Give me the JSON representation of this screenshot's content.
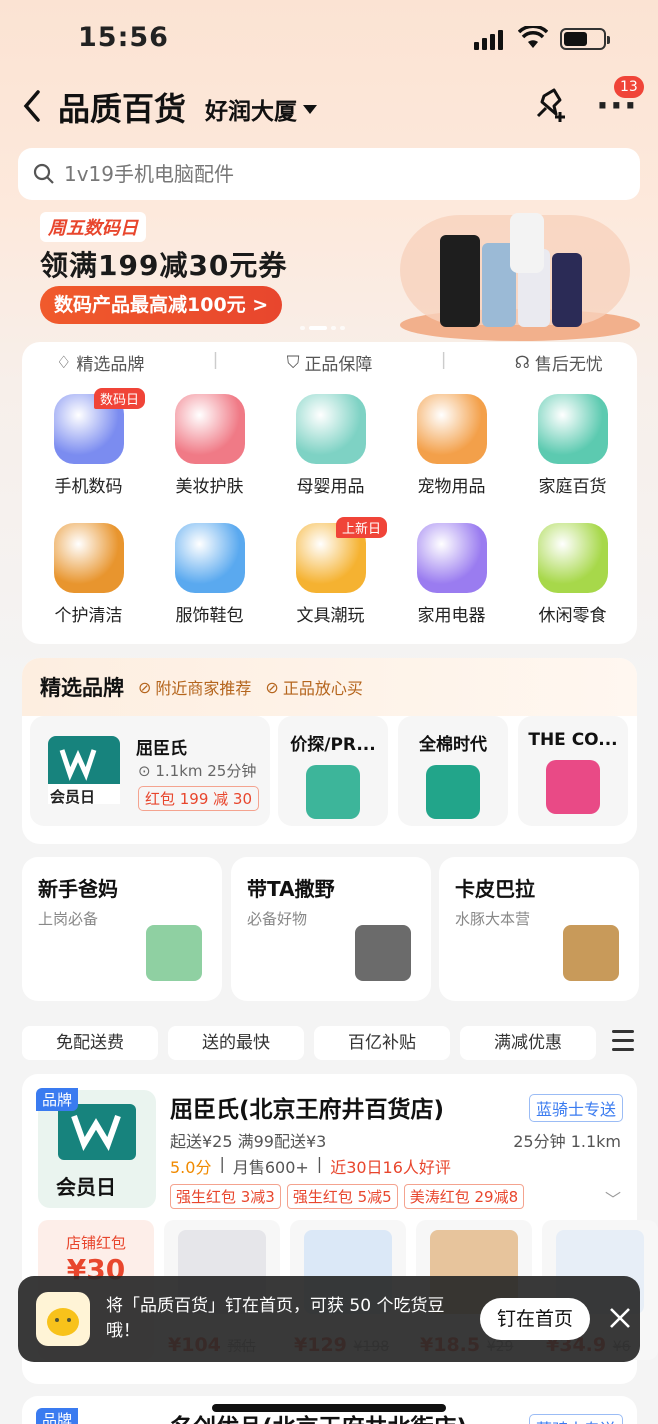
{
  "status": {
    "time": "15:56"
  },
  "header": {
    "title": "品质百货",
    "location": "好润大厦",
    "notif_count": "13"
  },
  "search": {
    "placeholder": "1v19手机电脑配件"
  },
  "banner": {
    "tag": "周五数码日",
    "title": "领满199减30元券",
    "button": "数码产品最高减100元 >"
  },
  "assurances": [
    "精选品牌",
    "正品保障",
    "售后无忧"
  ],
  "categories": [
    {
      "label": "手机数码",
      "tag": "数码日",
      "color": "#7b8cf0"
    },
    {
      "label": "美妆护肤",
      "tag": "",
      "color": "#f07a86"
    },
    {
      "label": "母婴用品",
      "tag": "",
      "color": "#7ed2c4"
    },
    {
      "label": "宠物用品",
      "tag": "",
      "color": "#f3a04a"
    },
    {
      "label": "家庭百货",
      "tag": "",
      "color": "#5ccab0"
    },
    {
      "label": "个护清洁",
      "tag": "",
      "color": "#e8952e"
    },
    {
      "label": "服饰鞋包",
      "tag": "",
      "color": "#5aa9ef"
    },
    {
      "label": "文具潮玩",
      "tag": "上新日",
      "color": "#f5b231"
    },
    {
      "label": "家用电器",
      "tag": "",
      "color": "#9a7cf0"
    },
    {
      "label": "休闲零食",
      "tag": "",
      "color": "#a7d84a"
    }
  ],
  "brands": {
    "title": "精选品牌",
    "badges": [
      "附近商家推荐",
      "正品放心买"
    ],
    "main": {
      "name": "屈臣氏",
      "distance": "1.1km 25分钟",
      "coupon": "红包 199 减 30",
      "member": "会员日"
    },
    "minis": [
      {
        "name": "价探/PR...",
        "color": "#3db59a"
      },
      {
        "name": "全棉时代",
        "color": "#22a58a"
      },
      {
        "name": "THE CO...",
        "color": "#e94a86"
      }
    ]
  },
  "topics": [
    {
      "title": "新手爸妈",
      "sub": "上岗必备",
      "color": "#8fd0a2"
    },
    {
      "title": "带TA撒野",
      "sub": "必备好物",
      "color": "#6b6b6b"
    },
    {
      "title": "卡皮巴拉",
      "sub": "水豚大本营",
      "color": "#c89a5a"
    }
  ],
  "filters": [
    "免配送费",
    "送的最快",
    "百亿补贴",
    "满减优惠"
  ],
  "store": {
    "brand_tag": "品牌",
    "member": "会员日",
    "name": "屈臣氏(北京王府井百货店)",
    "delivery_badge": "蓝骑士专送",
    "delivery": "起送¥25  满99配送¥3",
    "eta": "25分钟  1.1km",
    "score": "5.0分",
    "sales": "月售600+",
    "reviews": "近30日16人好评",
    "coupons": [
      "强生红包 3减3",
      "强生红包 5减5",
      "美涛红包 29减8"
    ],
    "shop_coupon": {
      "label": "店铺红包",
      "amount": "¥30"
    },
    "products": [
      {
        "price": "¥104",
        "old": "预估",
        "color": "#e6e6ea"
      },
      {
        "price": "¥129",
        "old": "¥198",
        "color": "#dbe8f7"
      },
      {
        "price": "¥18.5",
        "old": "¥29",
        "color": "#e7c49c"
      },
      {
        "price": "¥34.9",
        "old": "¥6",
        "color": "#e7eef7"
      }
    ]
  },
  "toast": {
    "message": "将「品质百货」钉在首页，可获 50 个吃货豆哦！",
    "button": "钉在首页"
  },
  "store2": {
    "brand_tag": "品牌",
    "name": "名创优品(北京王府井北街店)",
    "delivery_badge": "蓝骑士专送"
  }
}
